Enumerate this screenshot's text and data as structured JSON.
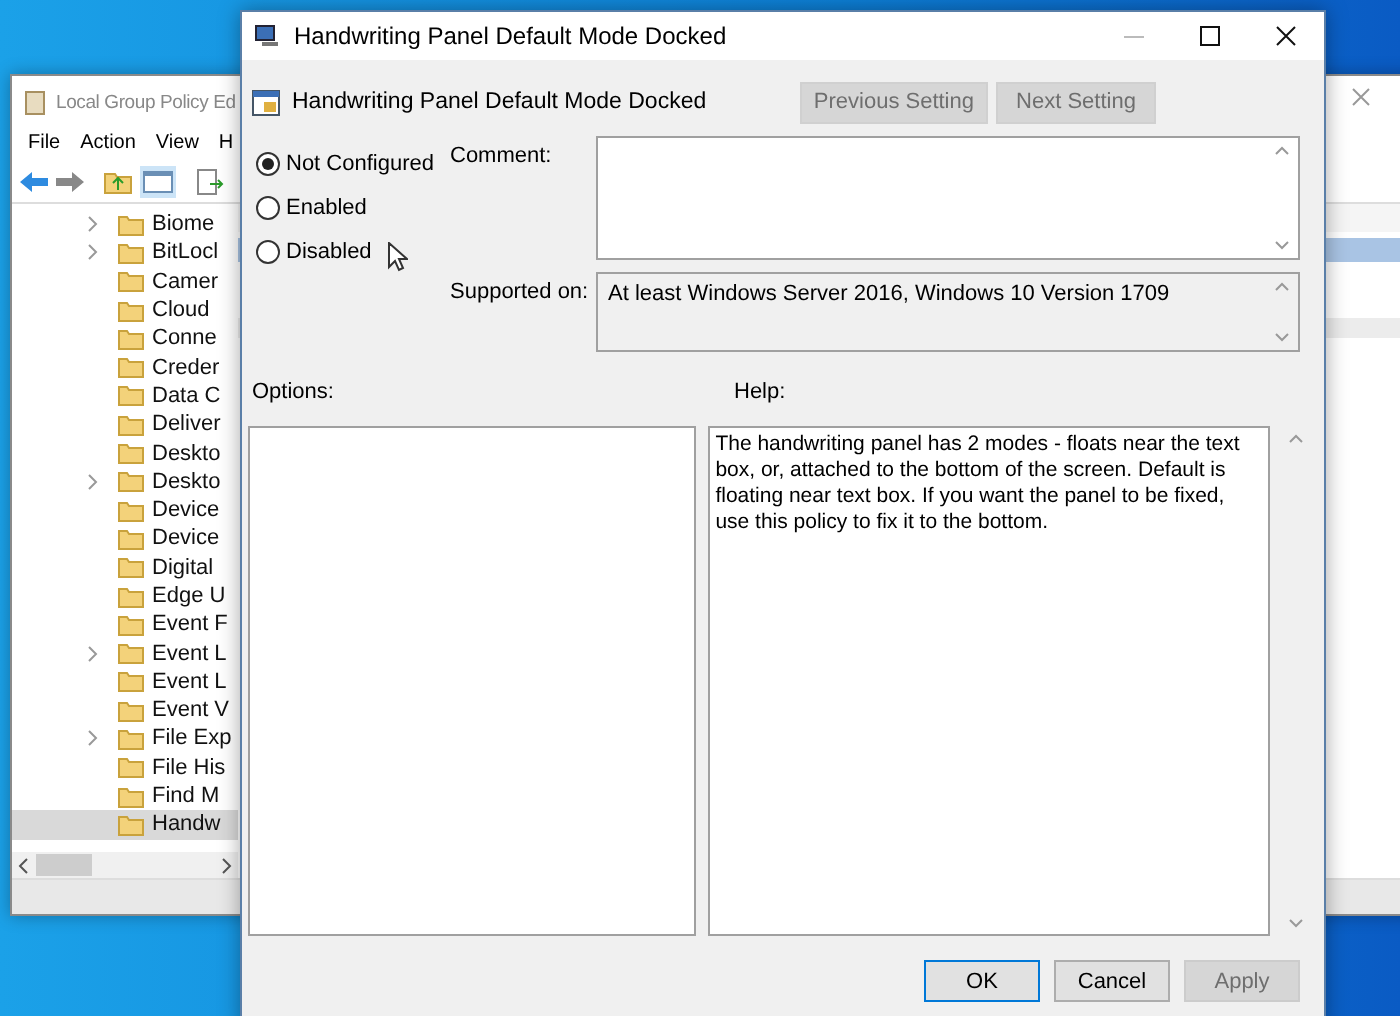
{
  "background_window": {
    "title": "Local Group Policy Ed",
    "menu": [
      "File",
      "Action",
      "View",
      "H"
    ],
    "tree": [
      {
        "label": "Biome",
        "expandable": true,
        "selected": false
      },
      {
        "label": "BitLocl",
        "expandable": true,
        "selected": false
      },
      {
        "label": "Camer",
        "expandable": false,
        "selected": false
      },
      {
        "label": "Cloud",
        "expandable": false,
        "selected": false
      },
      {
        "label": "Conne",
        "expandable": false,
        "selected": false
      },
      {
        "label": "Creder",
        "expandable": false,
        "selected": false
      },
      {
        "label": "Data C",
        "expandable": false,
        "selected": false
      },
      {
        "label": "Deliver",
        "expandable": false,
        "selected": false
      },
      {
        "label": "Deskto",
        "expandable": false,
        "selected": false
      },
      {
        "label": "Deskto",
        "expandable": true,
        "selected": false
      },
      {
        "label": "Device",
        "expandable": false,
        "selected": false
      },
      {
        "label": "Device",
        "expandable": false,
        "selected": false
      },
      {
        "label": "Digital",
        "expandable": false,
        "selected": false
      },
      {
        "label": "Edge U",
        "expandable": false,
        "selected": false
      },
      {
        "label": "Event F",
        "expandable": false,
        "selected": false
      },
      {
        "label": "Event L",
        "expandable": true,
        "selected": false
      },
      {
        "label": "Event L",
        "expandable": false,
        "selected": false
      },
      {
        "label": "Event V",
        "expandable": false,
        "selected": false
      },
      {
        "label": "File Exp",
        "expandable": true,
        "selected": false
      },
      {
        "label": "File His",
        "expandable": false,
        "selected": false
      },
      {
        "label": "Find M",
        "expandable": false,
        "selected": false
      },
      {
        "label": "Handw",
        "expandable": false,
        "selected": true
      }
    ]
  },
  "dialog": {
    "title": "Handwriting Panel Default Mode Docked",
    "setting_name": "Handwriting Panel Default Mode Docked",
    "nav_buttons": [
      {
        "label": "Previous Setting",
        "disabled": true
      },
      {
        "label": "Next Setting",
        "disabled": true
      }
    ],
    "states": [
      {
        "label": "Not Configured",
        "selected": true
      },
      {
        "label": "Enabled",
        "selected": false
      },
      {
        "label": "Disabled",
        "selected": false
      }
    ],
    "comment_label": "Comment:",
    "supported_label": "Supported on:",
    "supported_text": "At least Windows Server 2016, Windows 10 Version 1709",
    "options_label": "Options:",
    "help_label": "Help:",
    "help_text": "The handwriting panel has 2 modes - floats near the text box, or, attached to the bottom of the screen. Default is floating near text box. If you want the panel to be fixed, use this policy to fix it to the bottom.",
    "buttons": [
      {
        "label": "OK",
        "default": true,
        "disabled": false
      },
      {
        "label": "Cancel",
        "default": false,
        "disabled": false
      },
      {
        "label": "Apply",
        "default": false,
        "disabled": true
      }
    ]
  }
}
